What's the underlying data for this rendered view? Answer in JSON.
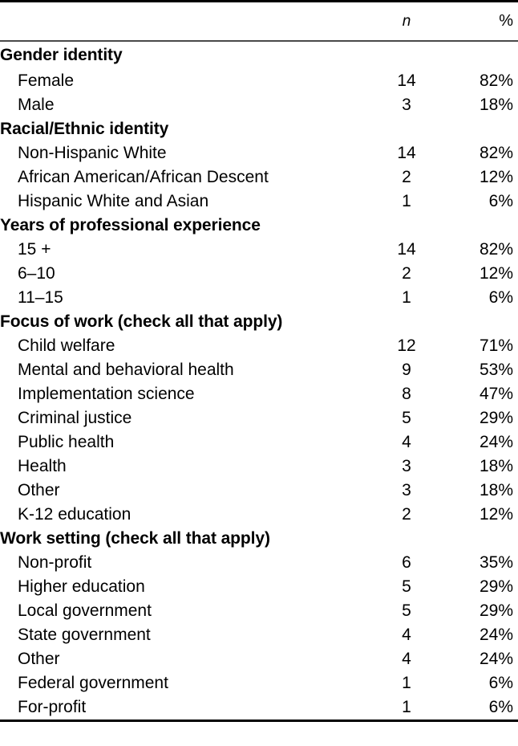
{
  "table": {
    "columns": {
      "label_header": "",
      "n_header": "n",
      "pct_header": "%"
    },
    "rows": [
      {
        "type": "section",
        "label": "Gender identity",
        "n": "",
        "pct": ""
      },
      {
        "type": "item",
        "label": "Female",
        "n": "14",
        "pct": "82%"
      },
      {
        "type": "item",
        "label": "Male",
        "n": "3",
        "pct": "18%"
      },
      {
        "type": "section",
        "label": "Racial/Ethnic identity",
        "n": "",
        "pct": ""
      },
      {
        "type": "item",
        "label": "Non-Hispanic White",
        "n": "14",
        "pct": "82%"
      },
      {
        "type": "item",
        "label": "African American/African Descent",
        "n": "2",
        "pct": "12%"
      },
      {
        "type": "item",
        "label": "Hispanic White and Asian",
        "n": "1",
        "pct": "6%"
      },
      {
        "type": "section",
        "label": "Years of professional experience",
        "n": "",
        "pct": ""
      },
      {
        "type": "item",
        "label": "15 +",
        "n": "14",
        "pct": "82%"
      },
      {
        "type": "item",
        "label": "6–10",
        "n": "2",
        "pct": "12%"
      },
      {
        "type": "item",
        "label": "11–15",
        "n": "1",
        "pct": "6%"
      },
      {
        "type": "section",
        "label": "Focus of work (check all that apply)",
        "n": "",
        "pct": ""
      },
      {
        "type": "item",
        "label": "Child welfare",
        "n": "12",
        "pct": "71%"
      },
      {
        "type": "item",
        "label": "Mental and behavioral health",
        "n": "9",
        "pct": "53%"
      },
      {
        "type": "item",
        "label": "Implementation science",
        "n": "8",
        "pct": "47%"
      },
      {
        "type": "item",
        "label": "Criminal justice",
        "n": "5",
        "pct": "29%"
      },
      {
        "type": "item",
        "label": "Public health",
        "n": "4",
        "pct": "24%"
      },
      {
        "type": "item",
        "label": "Health",
        "n": "3",
        "pct": "18%"
      },
      {
        "type": "item",
        "label": "Other",
        "n": "3",
        "pct": "18%"
      },
      {
        "type": "item",
        "label": "K-12 education",
        "n": "2",
        "pct": "12%"
      },
      {
        "type": "section",
        "label": "Work setting (check all that apply)",
        "n": "",
        "pct": ""
      },
      {
        "type": "item",
        "label": "Non-profit",
        "n": "6",
        "pct": "35%"
      },
      {
        "type": "item",
        "label": "Higher education",
        "n": "5",
        "pct": "29%"
      },
      {
        "type": "item",
        "label": "Local government",
        "n": "5",
        "pct": "29%"
      },
      {
        "type": "item",
        "label": "State government",
        "n": "4",
        "pct": "24%"
      },
      {
        "type": "item",
        "label": "Other",
        "n": "4",
        "pct": "24%"
      },
      {
        "type": "item",
        "label": "Federal government",
        "n": "1",
        "pct": "6%"
      },
      {
        "type": "item",
        "label": "For-profit",
        "n": "1",
        "pct": "6%"
      }
    ]
  },
  "colors": {
    "text": "#000000",
    "rule_heavy": "#000000",
    "rule_light": "#4a4a4a",
    "background": "#ffffff"
  }
}
